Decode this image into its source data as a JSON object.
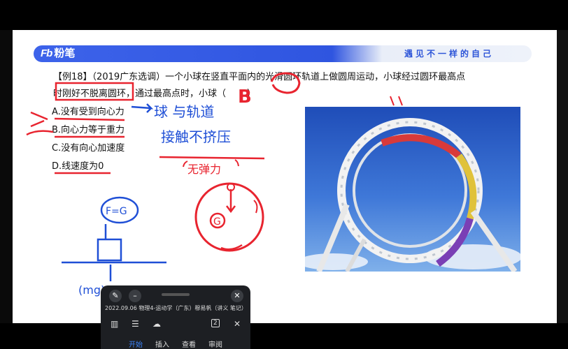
{
  "slide": {
    "brand": {
      "logo_mark": "Fb",
      "logo_text": "粉笔"
    },
    "tagline": "遇见不一样的自己",
    "question": {
      "tag": "【例18】",
      "source": "（2019广东选调）",
      "line1_rest": "一个小球在竖直平面内的光滑圆环轨道上做圆周运动，小球经过圆环最高点",
      "line2": "时刚好不脱离圆环，通过最高点时，小球（",
      "line2_close": "）"
    },
    "options": [
      {
        "label": "A.没有受到向心力"
      },
      {
        "label": "B.向心力等于重力"
      },
      {
        "label": "C.没有向心加速度"
      },
      {
        "label": "D.线速度为0"
      }
    ],
    "handwriting": {
      "answer": "B",
      "note1": "球 与轨道",
      "note2": "接触不挤压",
      "note3": "无弹力",
      "formula": "F=G",
      "mg_label": "(mg)",
      "circle_g": "G"
    }
  },
  "player": {
    "title": "2022.09.06 物理4-运动学（广东）穆易帆（讲义 笔记）（...",
    "page_count": "2",
    "tabs": [
      {
        "label": "开始",
        "active": true
      },
      {
        "label": "插入",
        "active": false
      },
      {
        "label": "查看",
        "active": false
      },
      {
        "label": "审阅",
        "active": false
      }
    ],
    "colors": {
      "active_tab": "#3b82f6",
      "background": "#1d1f23"
    }
  },
  "colors": {
    "banner_blue": "#2f55e0",
    "ink_red": "#e8242f",
    "ink_blue": "#1f4fd6",
    "photo_sky": "#2a5ec4"
  }
}
